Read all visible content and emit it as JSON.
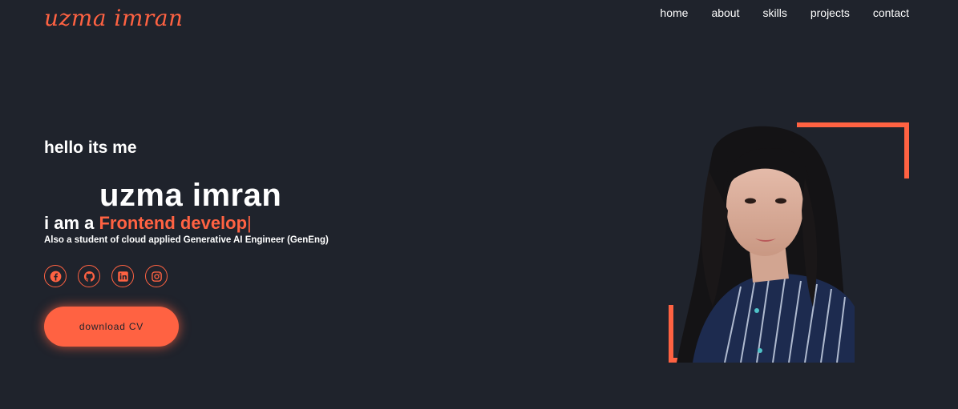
{
  "header": {
    "logo": "uzma imran",
    "nav": [
      {
        "label": "home"
      },
      {
        "label": "about"
      },
      {
        "label": "skills"
      },
      {
        "label": "projects"
      },
      {
        "label": "contact"
      }
    ]
  },
  "hero": {
    "greeting": "hello its me",
    "name": "uzma imran",
    "role_prefix": "i am a ",
    "role_typed": "Frontend develop",
    "caret": "|",
    "subtitle": "Also a student of cloud applied Generative AI Engineer (GenEng)",
    "socials": [
      {
        "icon": "facebook-icon"
      },
      {
        "icon": "github-icon"
      },
      {
        "icon": "linkedin-icon"
      },
      {
        "icon": "instagram-icon"
      }
    ],
    "cta_label": "download CV"
  },
  "colors": {
    "background": "#1f232c",
    "accent": "#ff6242",
    "text": "#ffffff"
  }
}
